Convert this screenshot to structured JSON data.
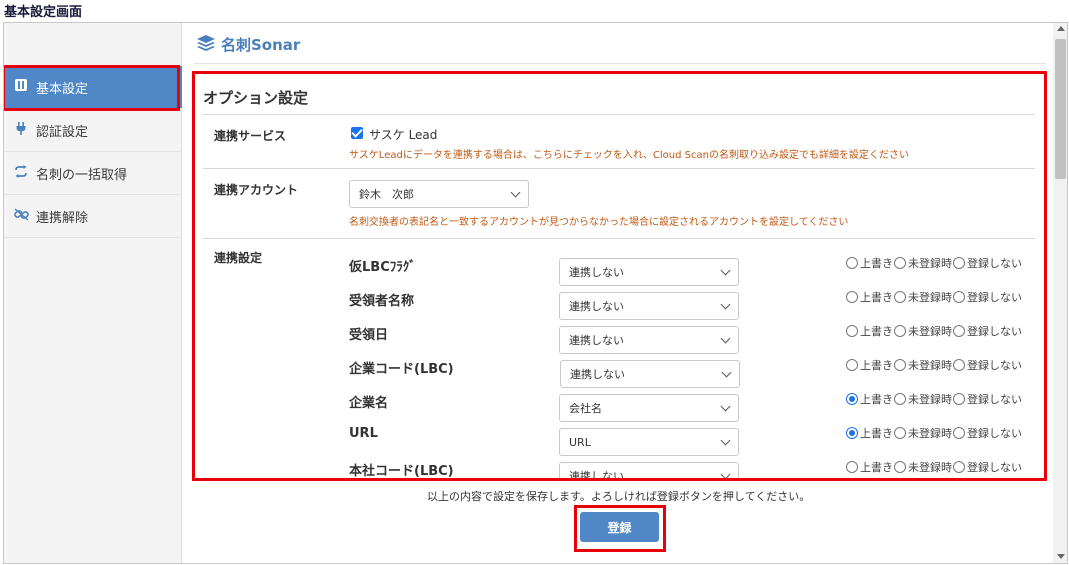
{
  "window_title": "基本設定画面",
  "brand": {
    "name": "名刺Sonar",
    "logo_icon": "layers-icon",
    "color": "#4a7fb9"
  },
  "sidebar": {
    "items": [
      {
        "label": "基本設定",
        "icon": "sliders-icon",
        "active": true
      },
      {
        "label": "認証設定",
        "icon": "plug-icon",
        "active": false
      },
      {
        "label": "名刺の一括取得",
        "icon": "sync-icon",
        "active": false
      },
      {
        "label": "連携解除",
        "icon": "unlink-icon",
        "active": false
      }
    ]
  },
  "options": {
    "title": "オプション設定",
    "service": {
      "label": "連携サービス",
      "checkbox_label": "サスケ Lead",
      "checked": true,
      "note": "サスケLeadにデータを連携する場合は、こちらにチェックを入れ、Cloud Scanの名刺取り込み設定でも詳細を設定ください"
    },
    "account": {
      "label": "連携アカウント",
      "value": "鈴木　次郎",
      "note": "名刺交換者の表記名と一致するアカウントが見つからなかった場合に設定されるアカウントを設定してください"
    },
    "mapping": {
      "label": "連携設定",
      "radio_labels": [
        "上書き",
        "未登録時",
        "登録しない"
      ],
      "rows": [
        {
          "name": "仮LBCﾌﾗｸﾞ",
          "value": "連携しない",
          "selected": -1
        },
        {
          "name": "受領者名称",
          "value": "連携しない",
          "selected": -1
        },
        {
          "name": "受領日",
          "value": "連携しない",
          "selected": -1
        },
        {
          "name": "企業コード(LBC)",
          "value": "連携しない",
          "selected": -1
        },
        {
          "name": "企業名",
          "value": "会社名",
          "selected": 0
        },
        {
          "name": "URL",
          "value": "URL",
          "selected": 0
        },
        {
          "name": "本社コード(LBC)",
          "value": "連携しない",
          "selected": -1
        }
      ]
    }
  },
  "footer": {
    "message": "以上の内容で設定を保存します。よろしければ登録ボタンを押してください。",
    "submit_label": "登録"
  },
  "colors": {
    "accent": "#4f87c7",
    "highlight": "#e8000b",
    "note": "#c05a16",
    "radio_selected": "#1a73e8"
  }
}
